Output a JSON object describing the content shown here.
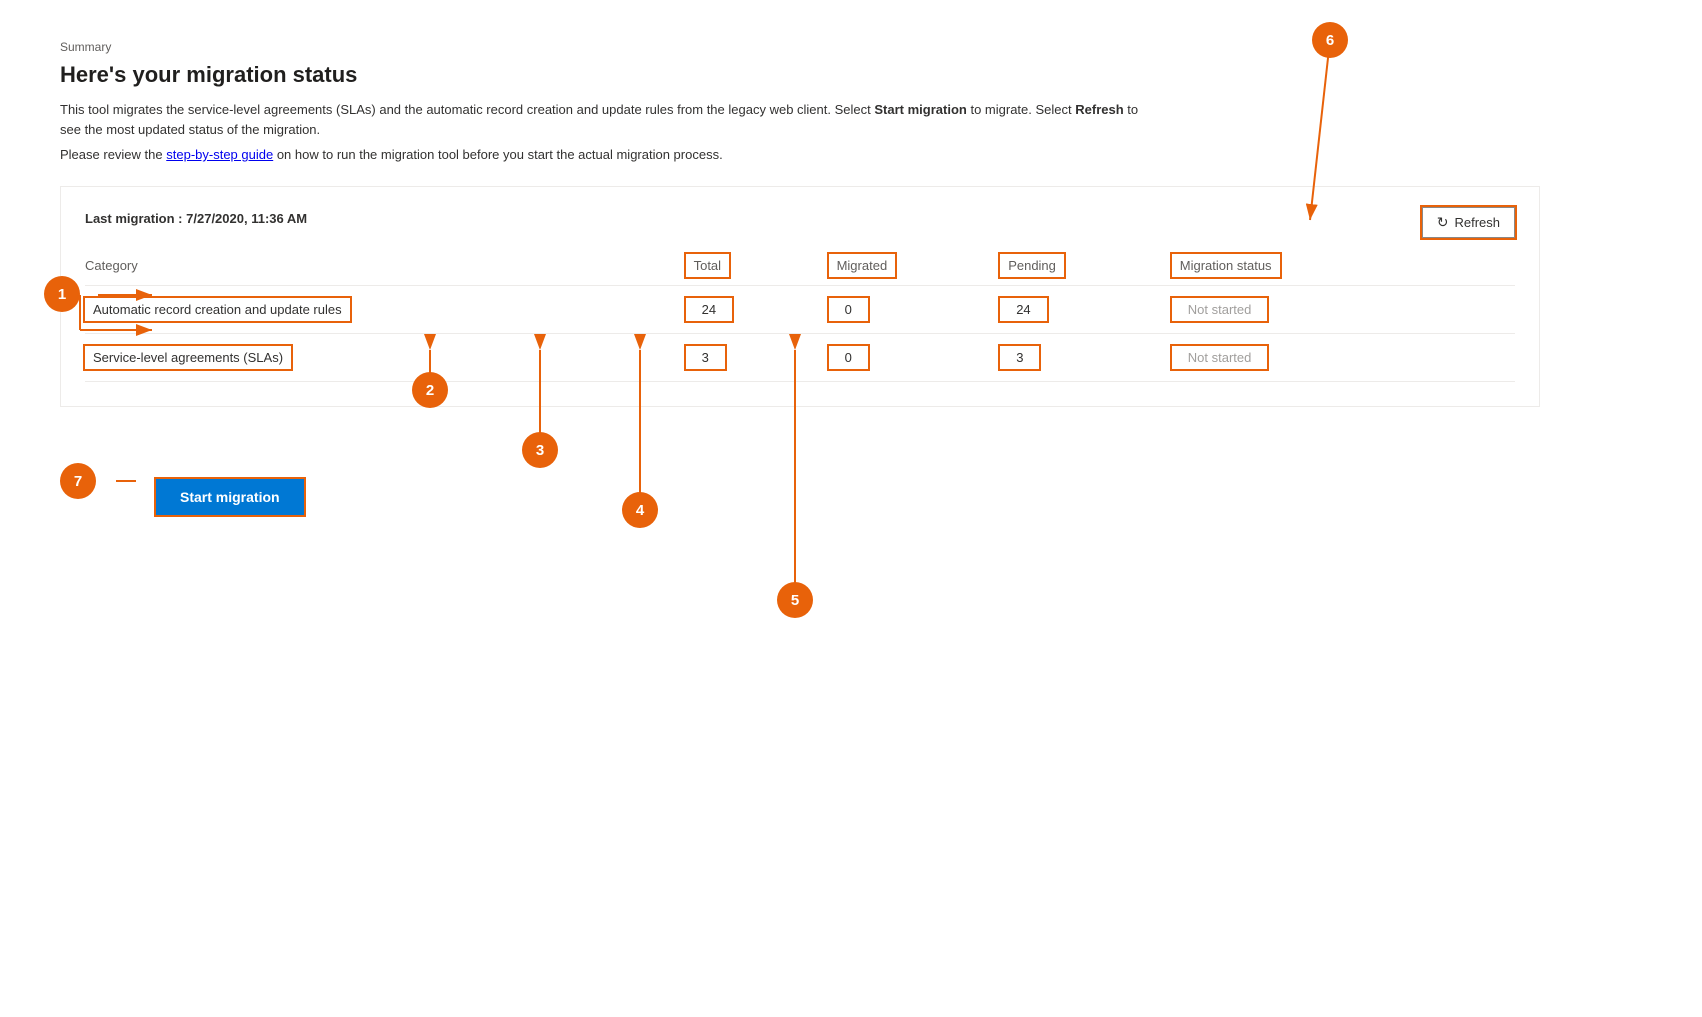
{
  "page": {
    "breadcrumb": "Summary",
    "title": "Here's your migration status",
    "description": "This tool migrates the service-level agreements (SLAs) and the automatic record creation and update rules from the legacy web client. Select",
    "description_bold1": "Start migration",
    "description_mid": "to migrate. Select",
    "description_bold2": "Refresh",
    "description_end": "to see the most updated status of the migration.",
    "guide_prefix": "Please review the",
    "guide_link": "step-by-step guide",
    "guide_suffix": "on how to run the migration tool before you start the actual migration process.",
    "last_migration_label": "Last migration :",
    "last_migration_value": "7/27/2020, 11:36 AM",
    "refresh_button": "Refresh",
    "table": {
      "headers": {
        "category": "Category",
        "total": "Total",
        "migrated": "Migrated",
        "pending": "Pending",
        "status": "Migration status"
      },
      "rows": [
        {
          "category": "Automatic record creation and update rules",
          "total": "24",
          "migrated": "0",
          "pending": "24",
          "status": "Not started"
        },
        {
          "category": "Service-level agreements (SLAs)",
          "total": "3",
          "migrated": "0",
          "pending": "3",
          "status": "Not started"
        }
      ]
    },
    "start_migration_button": "Start migration",
    "annotations": [
      1,
      2,
      3,
      4,
      5,
      6,
      7
    ]
  }
}
